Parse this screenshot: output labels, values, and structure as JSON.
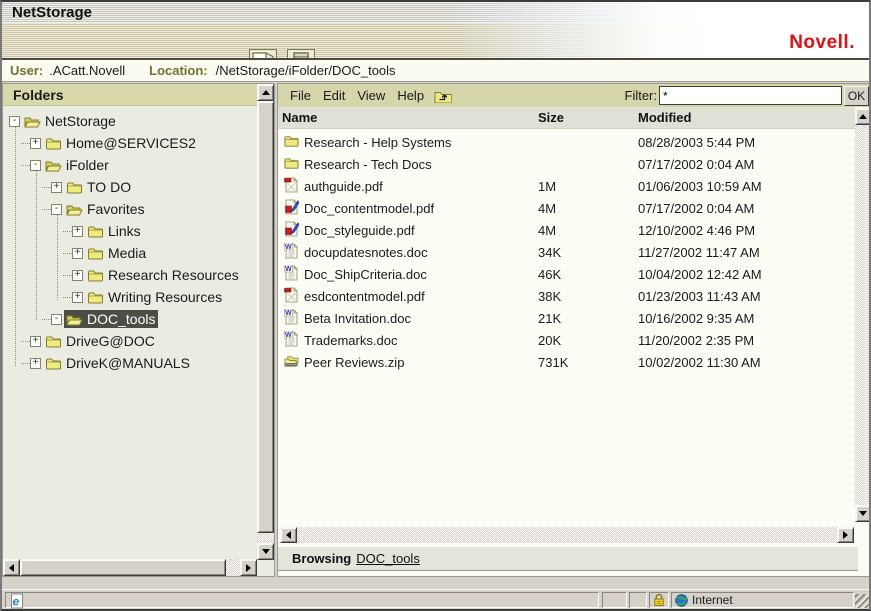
{
  "header": {
    "app_title": "NetStorage",
    "brand": "Novell.",
    "toolbar": [
      {
        "name": "exit",
        "icon": "door-exit-icon"
      },
      {
        "name": "properties",
        "icon": "document-icon"
      }
    ]
  },
  "userbar": {
    "user_label": "User:",
    "user_value": ".ACatt.Novell",
    "location_label": "Location:",
    "location_value": "/NetStorage/iFolder/DOC_tools"
  },
  "sidebar": {
    "title": "Folders",
    "items": [
      {
        "label": "NetStorage",
        "depth": 0,
        "expand": "minus",
        "folder": "open",
        "selected": false
      },
      {
        "label": "Home@SERVICES2",
        "depth": 1,
        "expand": "plus",
        "folder": "closed",
        "selected": false
      },
      {
        "label": "iFolder",
        "depth": 1,
        "expand": "minus",
        "folder": "open",
        "selected": false
      },
      {
        "label": "TO DO",
        "depth": 2,
        "expand": "plus",
        "folder": "closed",
        "selected": false
      },
      {
        "label": "Favorites",
        "depth": 2,
        "expand": "minus",
        "folder": "open",
        "selected": false
      },
      {
        "label": "Links",
        "depth": 3,
        "expand": "plus",
        "folder": "closed",
        "selected": false
      },
      {
        "label": "Media",
        "depth": 3,
        "expand": "plus",
        "folder": "closed",
        "selected": false
      },
      {
        "label": "Research Resources",
        "depth": 3,
        "expand": "plus",
        "folder": "closed",
        "selected": false
      },
      {
        "label": "Writing Resources",
        "depth": 3,
        "expand": "plus",
        "folder": "closed",
        "selected": false
      },
      {
        "label": "DOC_tools",
        "depth": 2,
        "expand": "minus",
        "folder": "open",
        "selected": true
      },
      {
        "label": "DriveG@DOC",
        "depth": 1,
        "expand": "plus",
        "folder": "closed",
        "selected": false
      },
      {
        "label": "DriveK@MANUALS",
        "depth": 1,
        "expand": "plus",
        "folder": "closed",
        "selected": false
      }
    ]
  },
  "menubar": {
    "items": [
      "File",
      "Edit",
      "View",
      "Help"
    ],
    "up_icon": "folder-up-icon",
    "filter_label": "Filter:",
    "filter_value": "*",
    "ok_label": "OK"
  },
  "files": {
    "columns": [
      "Name",
      "Size",
      "Modified"
    ],
    "rows": [
      {
        "icon": "folder",
        "name": "Research - Help Systems",
        "size": "",
        "modified": "08/28/2003 5:44 PM"
      },
      {
        "icon": "folder",
        "name": "Research - Tech Docs",
        "size": "",
        "modified": "07/17/2002 0:04 AM"
      },
      {
        "icon": "pdf",
        "name": "authguide.pdf",
        "size": "1M",
        "modified": "01/06/2003 10:59 AM"
      },
      {
        "icon": "pdf-pen",
        "name": "Doc_contentmodel.pdf",
        "size": "4M",
        "modified": "07/17/2002 0:04 AM"
      },
      {
        "icon": "pdf-pen",
        "name": "Doc_styleguide.pdf",
        "size": "4M",
        "modified": "12/10/2002 4:46 PM"
      },
      {
        "icon": "doc",
        "name": "docupdatesnotes.doc",
        "size": "34K",
        "modified": "11/27/2002 11:47 AM"
      },
      {
        "icon": "doc",
        "name": "Doc_ShipCriteria.doc",
        "size": "46K",
        "modified": "10/04/2002 12:42 AM"
      },
      {
        "icon": "pdf",
        "name": "esdcontentmodel.pdf",
        "size": "38K",
        "modified": "01/23/2003 11:43 AM"
      },
      {
        "icon": "doc",
        "name": "Beta Invitation.doc",
        "size": "21K",
        "modified": "10/16/2002 9:35 AM"
      },
      {
        "icon": "doc",
        "name": "Trademarks.doc",
        "size": "20K",
        "modified": "11/20/2002 2:35 PM"
      },
      {
        "icon": "zip",
        "name": "Peer Reviews.zip",
        "size": "731K",
        "modified": "10/02/2002 11:30 AM"
      }
    ]
  },
  "footer": {
    "browsing_label": "Browsing",
    "browsing_target": "DOC_tools"
  },
  "statusbar": {
    "zone_label": "Internet"
  },
  "colors": {
    "accent_olive": "#d5d6a9",
    "novell_red": "#e01010",
    "selection_gray": "#4c4e46"
  }
}
